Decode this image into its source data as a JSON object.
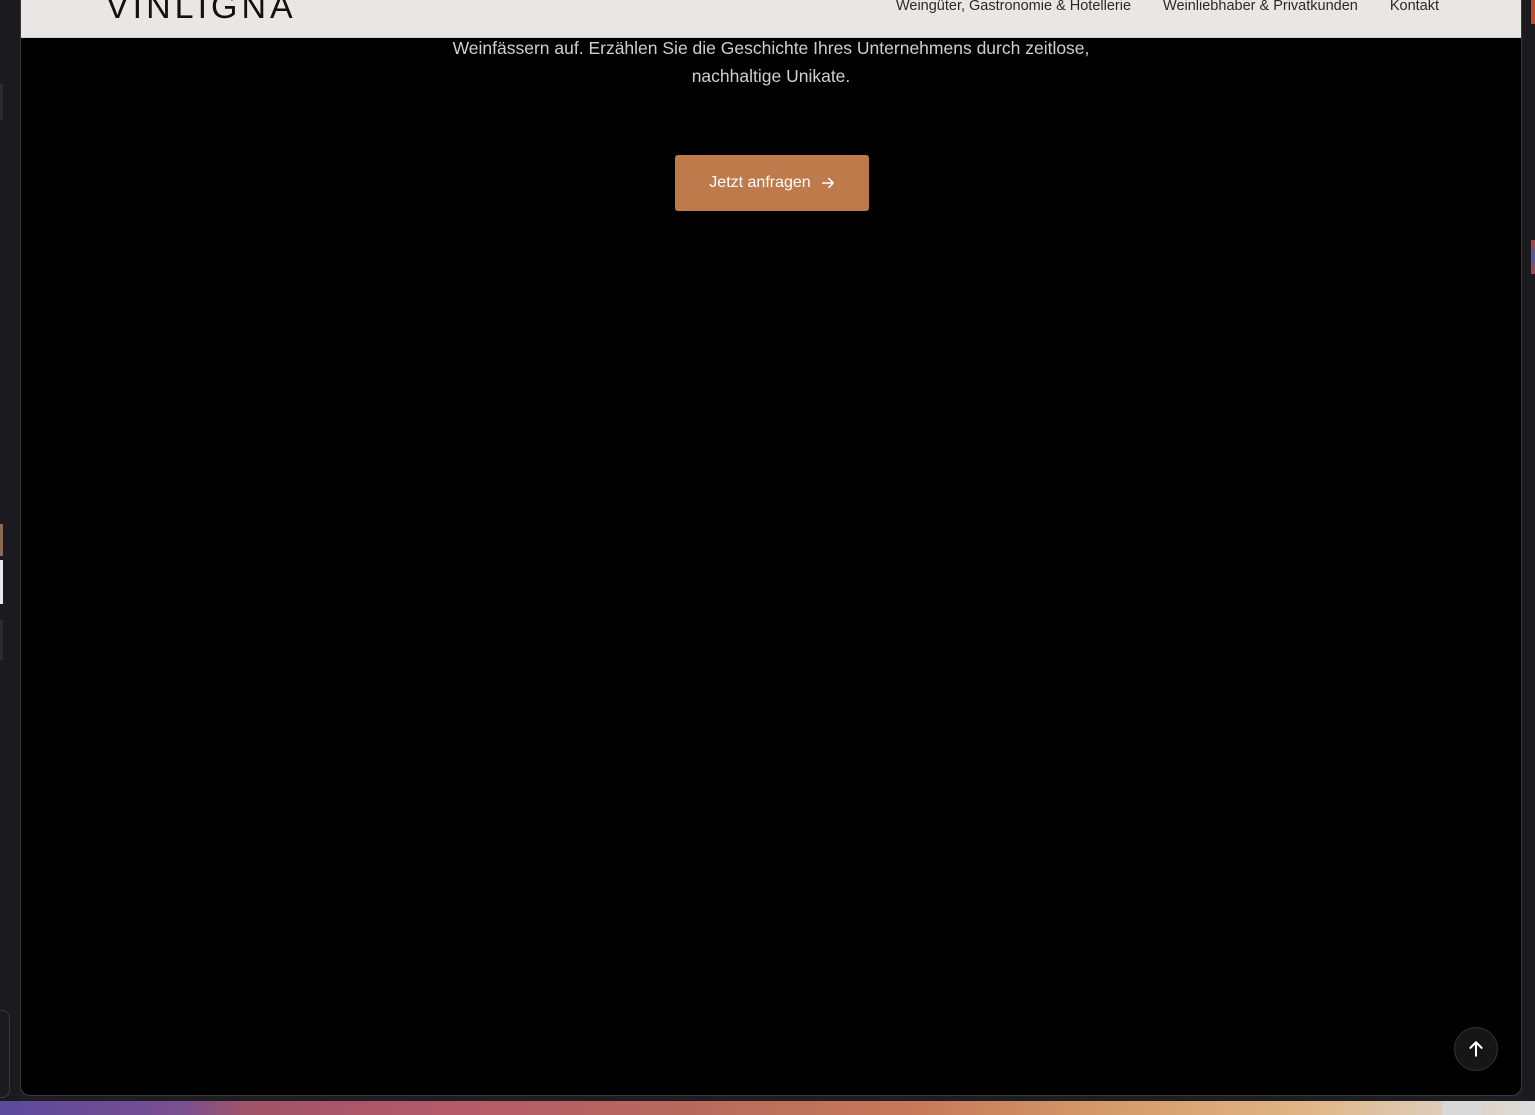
{
  "header": {
    "logo": "VINLIGNA",
    "nav": [
      {
        "label": "Weingüter, Gastronomie & Hotellerie"
      },
      {
        "label": "Weinliebhaber & Privatkunden"
      },
      {
        "label": "Kontakt"
      }
    ]
  },
  "hero": {
    "line1": "Weinfässern auf. Erzählen Sie die Geschichte Ihres Unternehmens durch zeitlose,",
    "line2": "nachhaltige Unikate.",
    "cta_label": "Jetzt anfragen"
  },
  "icons": {
    "cta_arrow": "arrow-right-icon",
    "scroll_top": "arrow-up-icon"
  },
  "colors": {
    "accent": "#bf7a4c",
    "header_bg": "#e8e7e5",
    "page_bg": "#000000"
  }
}
